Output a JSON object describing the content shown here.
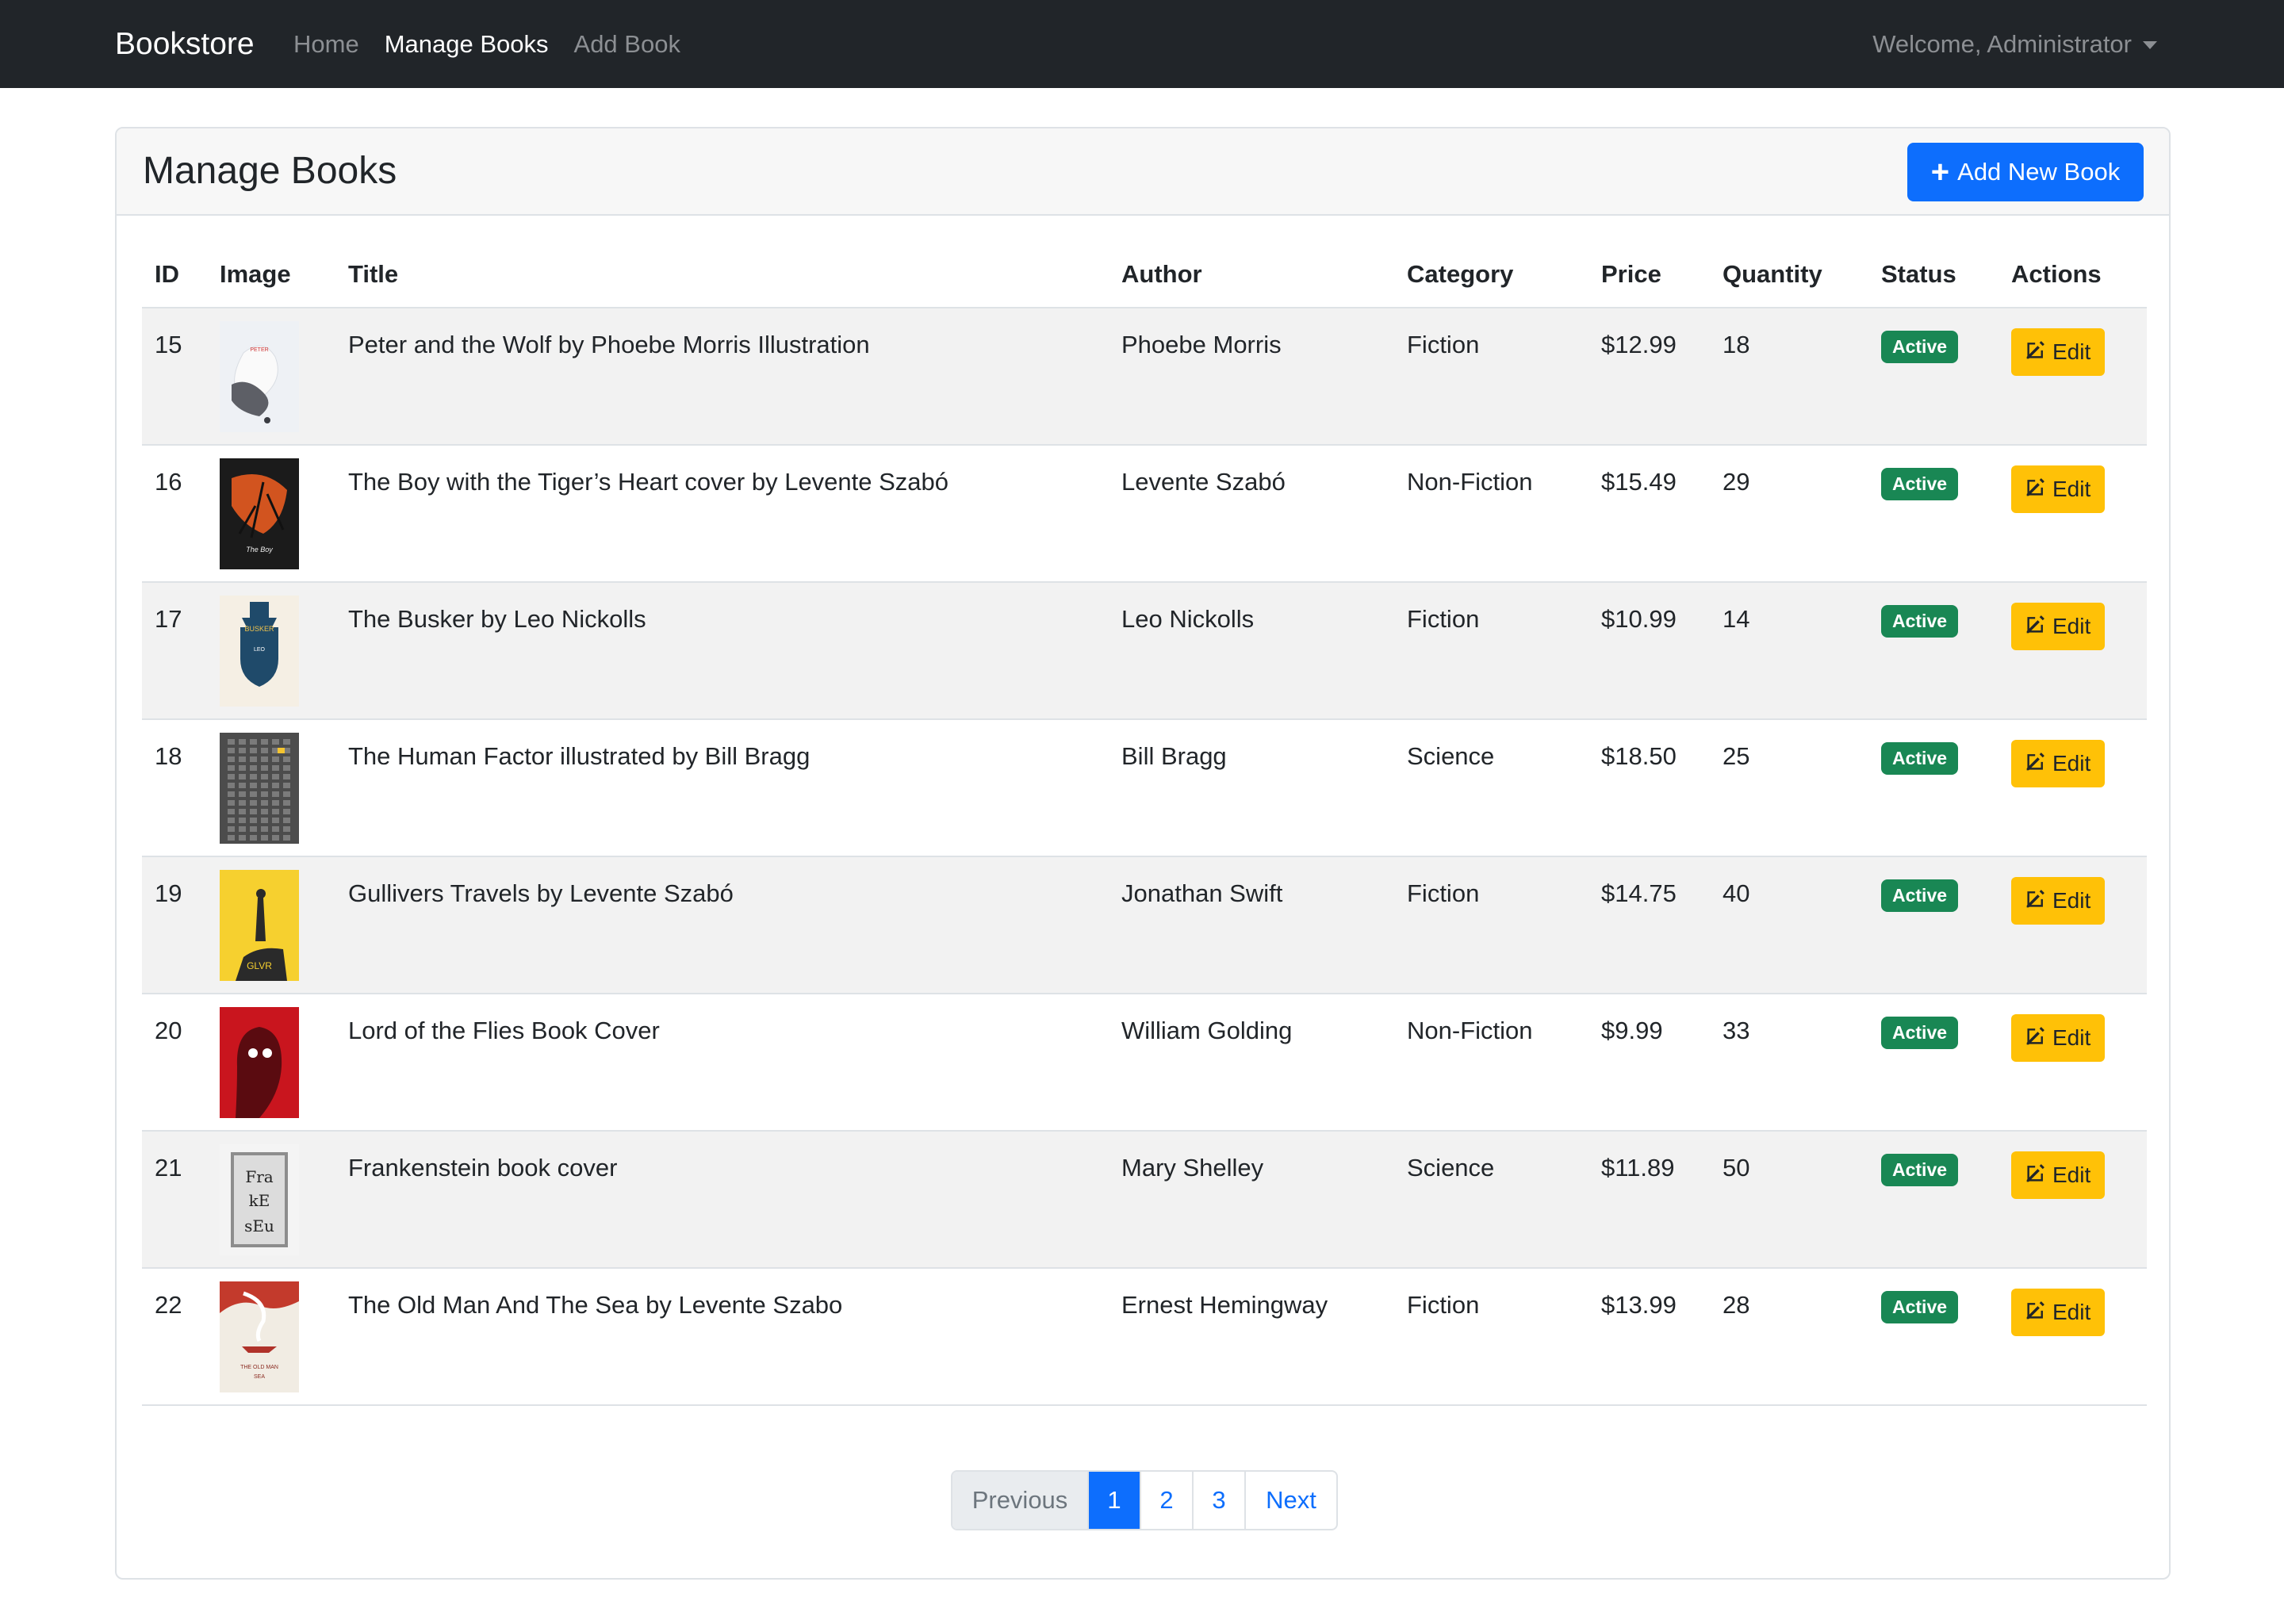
{
  "navbar": {
    "brand": "Bookstore",
    "links": [
      "Home",
      "Manage Books",
      "Add Book"
    ],
    "active_link": "Manage Books",
    "user_menu": "Welcome, Administrator"
  },
  "page": {
    "title": "Manage Books",
    "add_button": "Add New Book"
  },
  "table": {
    "headers": [
      "ID",
      "Image",
      "Title",
      "Author",
      "Category",
      "Price",
      "Quantity",
      "Status",
      "Actions"
    ],
    "rows": [
      {
        "id": "15",
        "title": "Peter and the Wolf by Phoebe Morris Illustration",
        "author": "Phoebe Morris",
        "category": "Fiction",
        "price": "$12.99",
        "quantity": "18",
        "status": "Active",
        "action": "Edit",
        "thumb": "peter-and-the-wolf-cover"
      },
      {
        "id": "16",
        "title": "The Boy with the Tiger’s Heart cover by Levente Szabó",
        "author": "Levente Szabó",
        "category": "Non-Fiction",
        "price": "$15.49",
        "quantity": "29",
        "status": "Active",
        "action": "Edit",
        "thumb": "boy-tiger-heart-cover"
      },
      {
        "id": "17",
        "title": "The Busker by Leo Nickolls",
        "author": "Leo Nickolls",
        "category": "Fiction",
        "price": "$10.99",
        "quantity": "14",
        "status": "Active",
        "action": "Edit",
        "thumb": "busker-cover"
      },
      {
        "id": "18",
        "title": "The Human Factor illustrated by Bill Bragg",
        "author": "Bill Bragg",
        "category": "Science",
        "price": "$18.50",
        "quantity": "25",
        "status": "Active",
        "action": "Edit",
        "thumb": "human-factor-cover"
      },
      {
        "id": "19",
        "title": "Gullivers Travels by Levente Szabó",
        "author": "Jonathan Swift",
        "category": "Fiction",
        "price": "$14.75",
        "quantity": "40",
        "status": "Active",
        "action": "Edit",
        "thumb": "gullivers-travels-cover"
      },
      {
        "id": "20",
        "title": "Lord of the Flies Book Cover",
        "author": "William Golding",
        "category": "Non-Fiction",
        "price": "$9.99",
        "quantity": "33",
        "status": "Active",
        "action": "Edit",
        "thumb": "lord-of-the-flies-cover"
      },
      {
        "id": "21",
        "title": "Frankenstein book cover",
        "author": "Mary Shelley",
        "category": "Science",
        "price": "$11.89",
        "quantity": "50",
        "status": "Active",
        "action": "Edit",
        "thumb": "frankenstein-cover"
      },
      {
        "id": "22",
        "title": "The Old Man And The Sea by Levente Szabo",
        "author": "Ernest Hemingway",
        "category": "Fiction",
        "price": "$13.99",
        "quantity": "28",
        "status": "Active",
        "action": "Edit",
        "thumb": "old-man-and-the-sea-cover"
      }
    ]
  },
  "pagination": {
    "previous": "Previous",
    "pages": [
      "1",
      "2",
      "3"
    ],
    "current": "1",
    "next": "Next"
  },
  "colors": {
    "navbar_bg": "#212529",
    "primary": "#0d6efd",
    "success": "#198754",
    "warning": "#ffc107"
  },
  "icons": {
    "add": "plus-icon",
    "edit": "edit-square-icon",
    "user_menu": "caret-down-icon"
  }
}
